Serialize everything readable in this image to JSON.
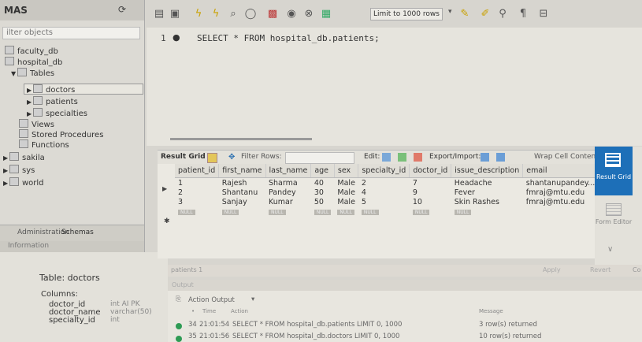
{
  "sidebar": {
    "title": "MAS",
    "filter_placeholder": "ilter objects",
    "tree": [
      {
        "label": "faculty_db",
        "indent": 0
      },
      {
        "label": "hospital_db",
        "indent": 0
      },
      {
        "label": "Tables",
        "indent": 1
      },
      {
        "label": "doctors",
        "indent": 2
      },
      {
        "label": "patients",
        "indent": 2
      },
      {
        "label": "specialties",
        "indent": 2
      },
      {
        "label": "Views",
        "indent": 1
      },
      {
        "label": "Stored Procedures",
        "indent": 1
      },
      {
        "label": "Functions",
        "indent": 1
      },
      {
        "label": "sakila",
        "indent": 0
      },
      {
        "label": "sys",
        "indent": 0
      },
      {
        "label": "world",
        "indent": 0
      }
    ],
    "tabs": {
      "admin": "Administration",
      "schemas": "Schemas"
    },
    "info_label": "Information",
    "info": {
      "table_label": "Table: doctors",
      "columns_label": "Columns:",
      "columns": [
        {
          "name": "doctor_id",
          "type": "int AI PK"
        },
        {
          "name": "doctor_name",
          "type": "varchar(50)"
        },
        {
          "name": "specialty_id",
          "type": "int"
        }
      ]
    }
  },
  "toolbar": {
    "limit_label": "Limit to 1000 rows"
  },
  "editor": {
    "line_number": "1",
    "sql": "SELECT * FROM hospital_db.patients;"
  },
  "result_toolbar": {
    "result_grid": "Result Grid",
    "filter_rows": "Filter Rows:",
    "edit": "Edit:",
    "export_import": "Export/Import:",
    "wrap": "Wrap Cell Content"
  },
  "grid": {
    "columns": [
      "patient_id",
      "first_name",
      "last_name",
      "age",
      "sex",
      "specialty_id",
      "doctor_id",
      "issue_description",
      "email"
    ],
    "rows": [
      [
        "1",
        "Rajesh",
        "Sharma",
        "40",
        "Male",
        "2",
        "7",
        "Headache",
        "shantanupandey..."
      ],
      [
        "2",
        "Shantanu",
        "Pandey",
        "30",
        "Male",
        "4",
        "9",
        "Fever",
        "fmraj@mtu.edu"
      ],
      [
        "3",
        "Sanjay",
        "Kumar",
        "50",
        "Male",
        "5",
        "10",
        "Skin Rashes",
        "fmraj@mtu.edu"
      ]
    ],
    "null_label": "NULL"
  },
  "right_panel": {
    "result_grid": "Result Grid",
    "form_editor": "Form Editor"
  },
  "lower": {
    "tab": "patients 1",
    "apply": "Apply",
    "revert": "Revert",
    "co": "Co"
  },
  "output": {
    "label": "Output",
    "mode": "Action Output",
    "headers": {
      "time": "Time",
      "action": "Action",
      "message": "Message"
    },
    "rows": [
      {
        "num": "34",
        "time": "21:01:54",
        "action": "SELECT * FROM hospital_db.patients LIMIT 0, 1000",
        "message": "3 row(s) returned"
      },
      {
        "num": "35",
        "time": "21:01:56",
        "action": "SELECT * FROM hospital_db.doctors LIMIT 0, 1000",
        "message": "10 row(s) returned"
      }
    ]
  },
  "colors": {
    "accent": "#1d6fb8",
    "success": "#2e9b54"
  }
}
